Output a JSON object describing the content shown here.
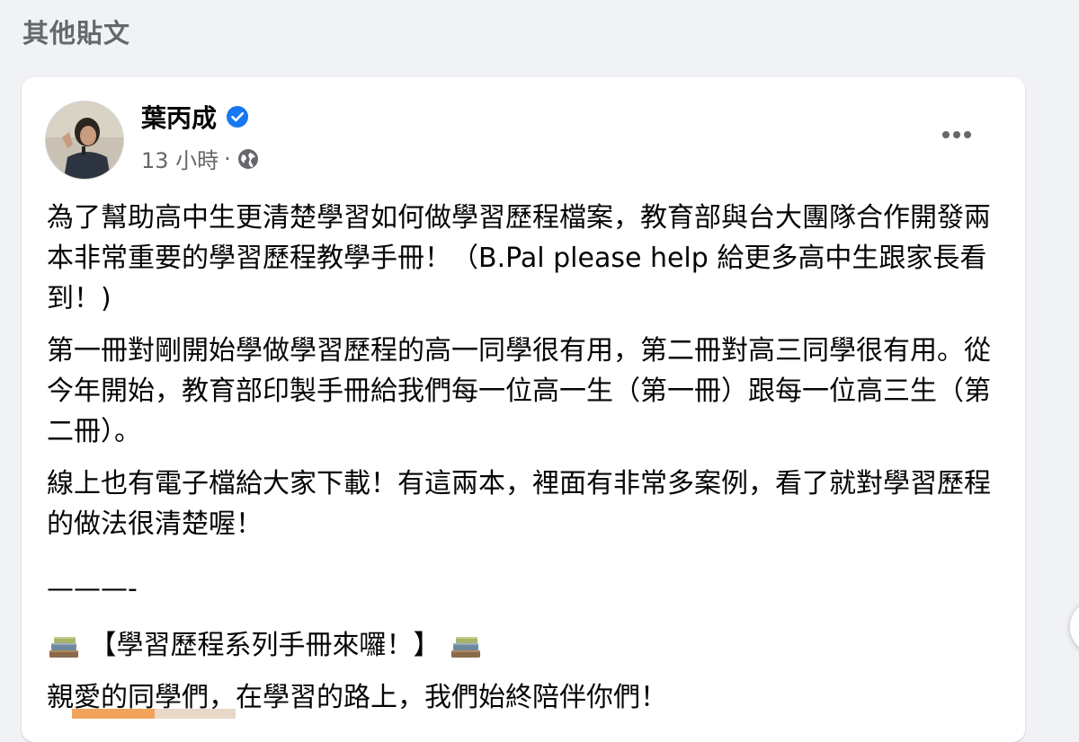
{
  "section": {
    "title": "其他貼文"
  },
  "post": {
    "author": {
      "name": "葉丙成",
      "verified": true
    },
    "meta": {
      "time": "13 小時",
      "separator": "·",
      "audience_icon": "globe-icon"
    },
    "more_icon": "more-options-icon",
    "paragraphs": [
      "為了幫助高中生更清楚學習如何做學習歷程檔案，教育部與台大團隊合作開發兩本非常重要的學習歷程教學手冊！（B.Pal please help 給更多高中生跟家長看到！)",
      "第一冊對剛開始學做學習歷程的高一同學很有用，第二冊對高三同學很有用。從今年開始，教育部印製手冊給我們每一位高一生（第一冊）跟每一位高三生（第二冊）。",
      "線上也有電子檔給大家下載！有這兩本，裡面有非常多案例，看了就對學習歷程的做法很清楚喔！"
    ],
    "divider": "———-",
    "headline": "【學習歷程系列手冊來囉！】",
    "headline_icon": "books-icon",
    "last_line": "親愛的同學們，在學習的路上，我們始終陪伴你們！"
  },
  "colors": {
    "background": "#f0f2f5",
    "card": "#ffffff",
    "verified_badge": "#1877f2",
    "secondary_text": "#65676b"
  }
}
